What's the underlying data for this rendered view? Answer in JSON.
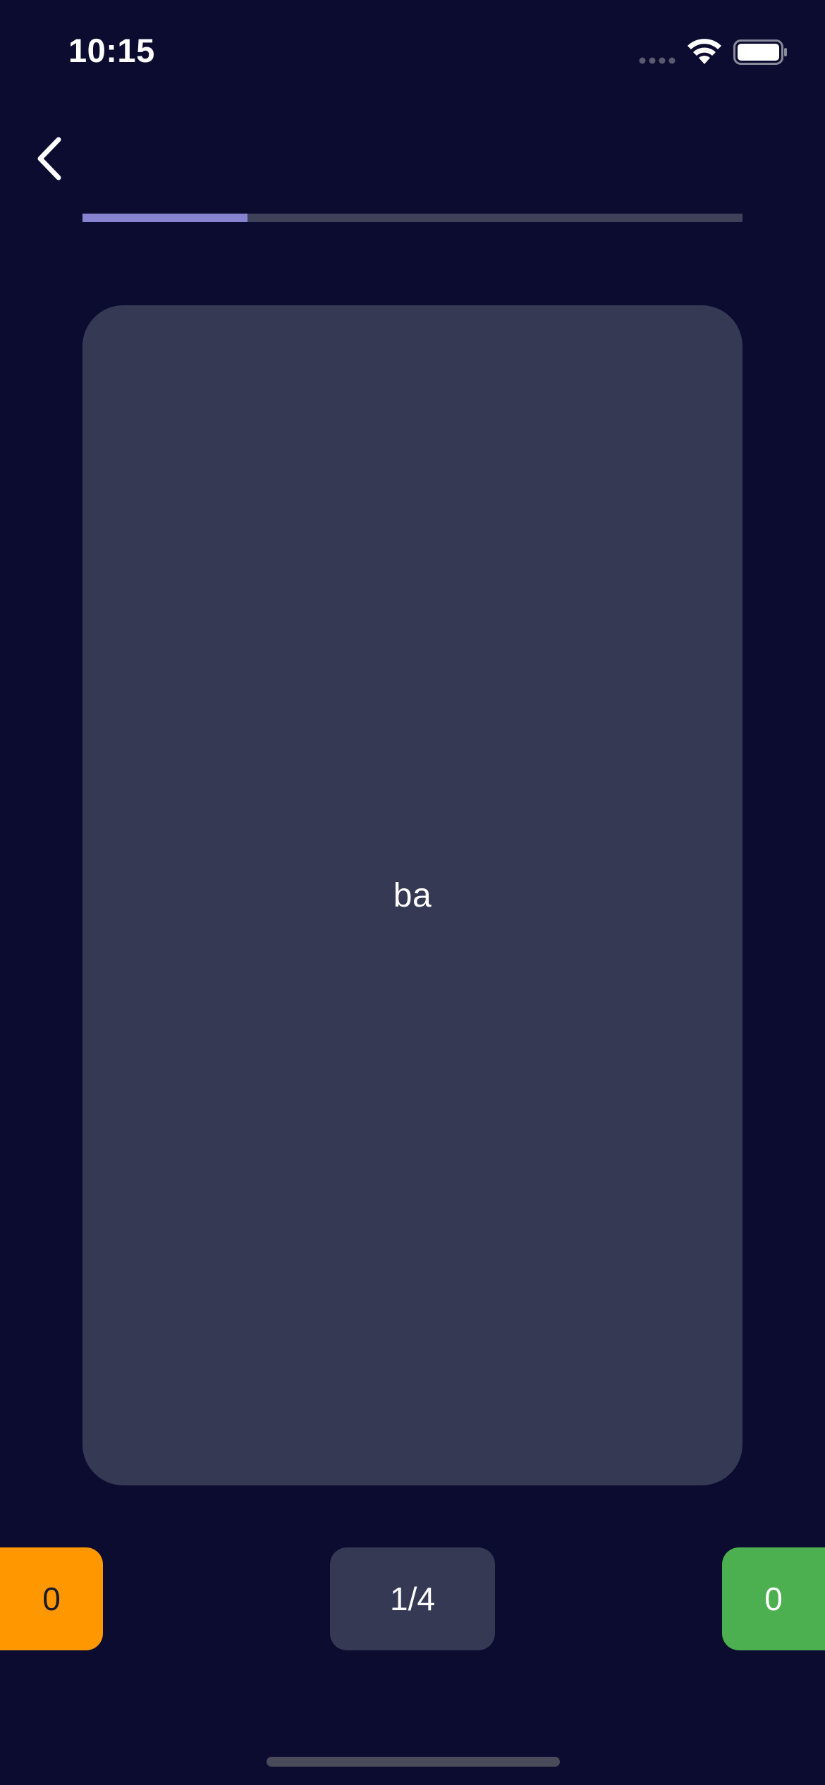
{
  "status_bar": {
    "time": "10:15",
    "icons": [
      "signal-icon",
      "wifi-icon",
      "battery-icon"
    ]
  },
  "nav": {
    "back_icon": "chevron-left-icon"
  },
  "progress": {
    "fraction": 0.25
  },
  "card": {
    "word": "ba"
  },
  "counters": {
    "left_value": "0",
    "middle_value": "1/4",
    "right_value": "0"
  },
  "colors": {
    "background": "#0b0c2f",
    "card": "#353954",
    "progress_fill": "#8783d0",
    "progress_track": "#3f4158",
    "left_counter": "#ff9800",
    "right_counter": "#4caf50"
  }
}
